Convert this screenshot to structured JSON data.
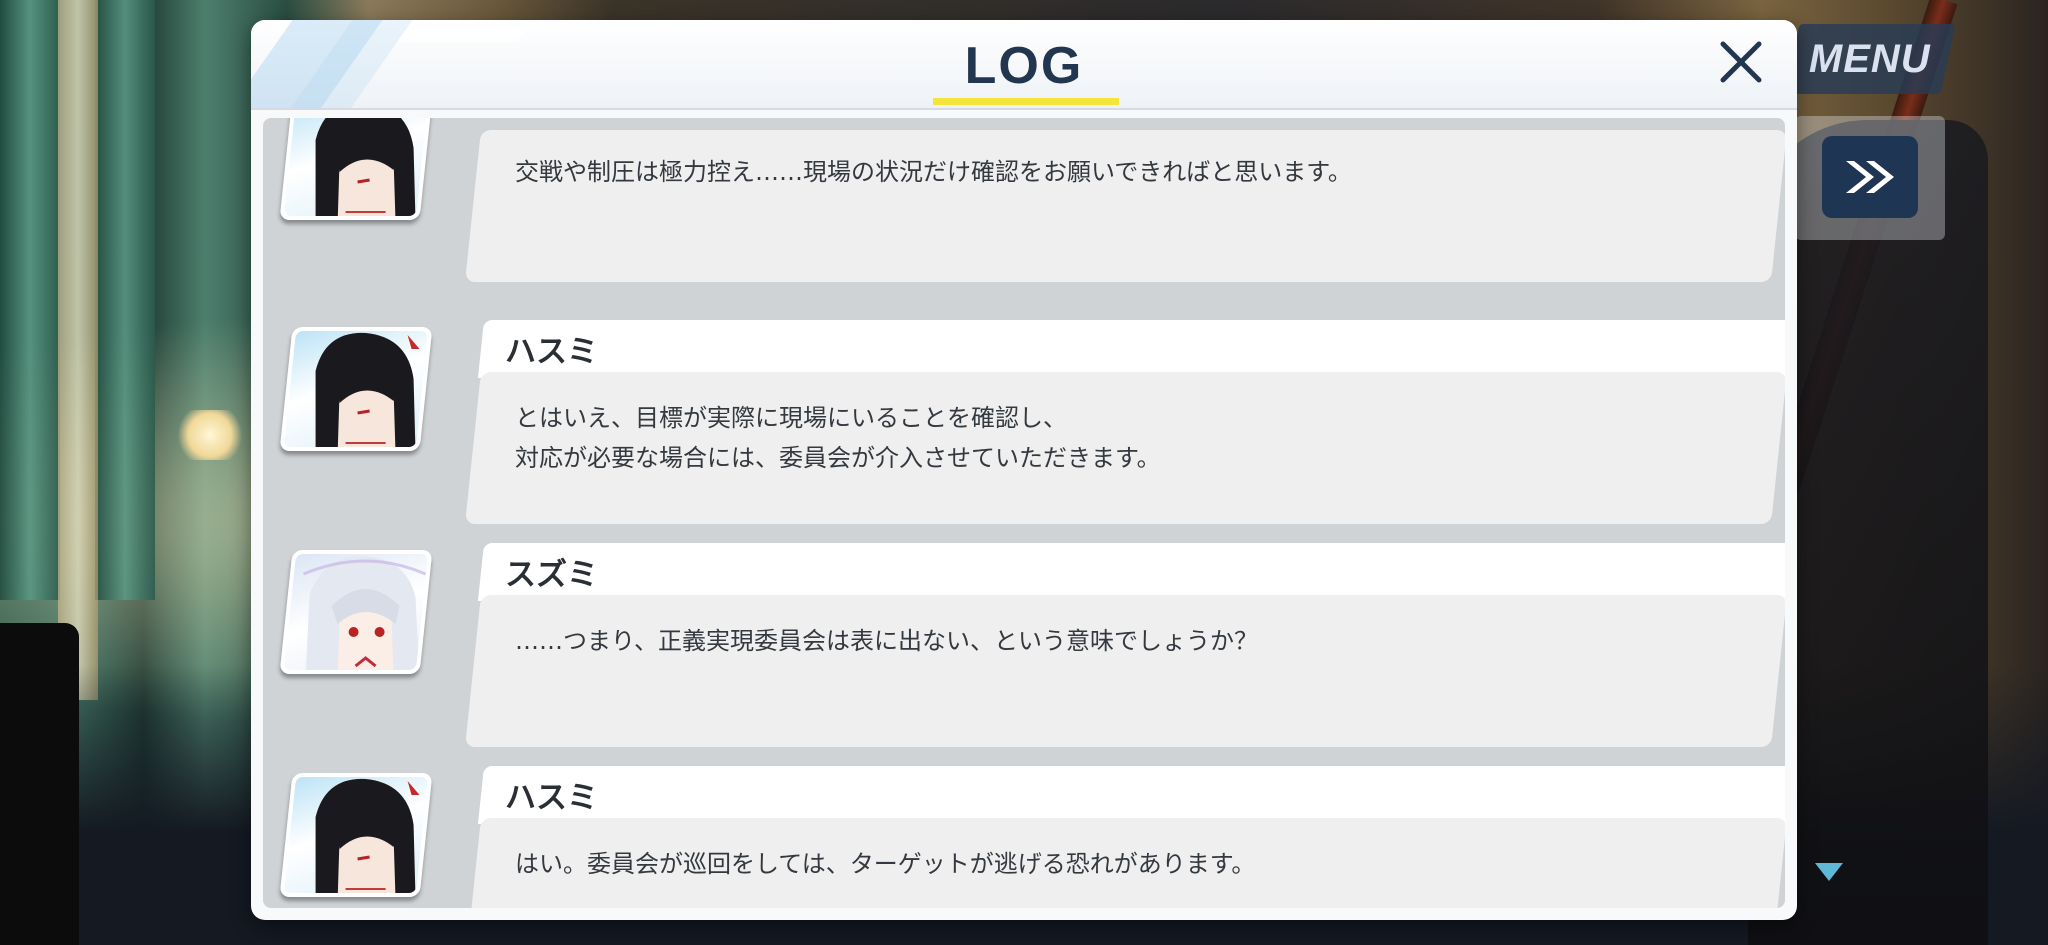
{
  "hud": {
    "menu_label": "MENU",
    "fast_forward_icon": "fast-forward-icon",
    "scroll_indicator_icon": "down-triangle-icon"
  },
  "log": {
    "title": "LOG",
    "close_icon": "close-icon",
    "entries": [
      {
        "speaker": "",
        "portrait": "hasumi-portrait",
        "lines": [
          "交戦や制圧は極力控え……現場の状況だけ確認をお願いできればと思います。"
        ]
      },
      {
        "speaker": "ハスミ",
        "portrait": "hasumi-portrait",
        "lines": [
          "とはいえ、目標が実際に現場にいることを確認し、",
          "対応が必要な場合には、委員会が介入させていただきます。"
        ]
      },
      {
        "speaker": "スズミ",
        "portrait": "suzumi-portrait",
        "lines": [
          "……つまり、正義実現委員会は表に出ない、という意味でしょうか？"
        ]
      },
      {
        "speaker": "ハスミ",
        "portrait": "hasumi-portrait",
        "lines": [
          "はい。委員会が巡回をしては、ターゲットが逃げる恐れがあります。"
        ]
      }
    ]
  },
  "colors": {
    "title_text": "#23364f",
    "title_underline": "#f5e43a",
    "panel_bg": "#f7f9fb",
    "bubble_bg": "#efefef",
    "hud_button": "#1e3553"
  }
}
